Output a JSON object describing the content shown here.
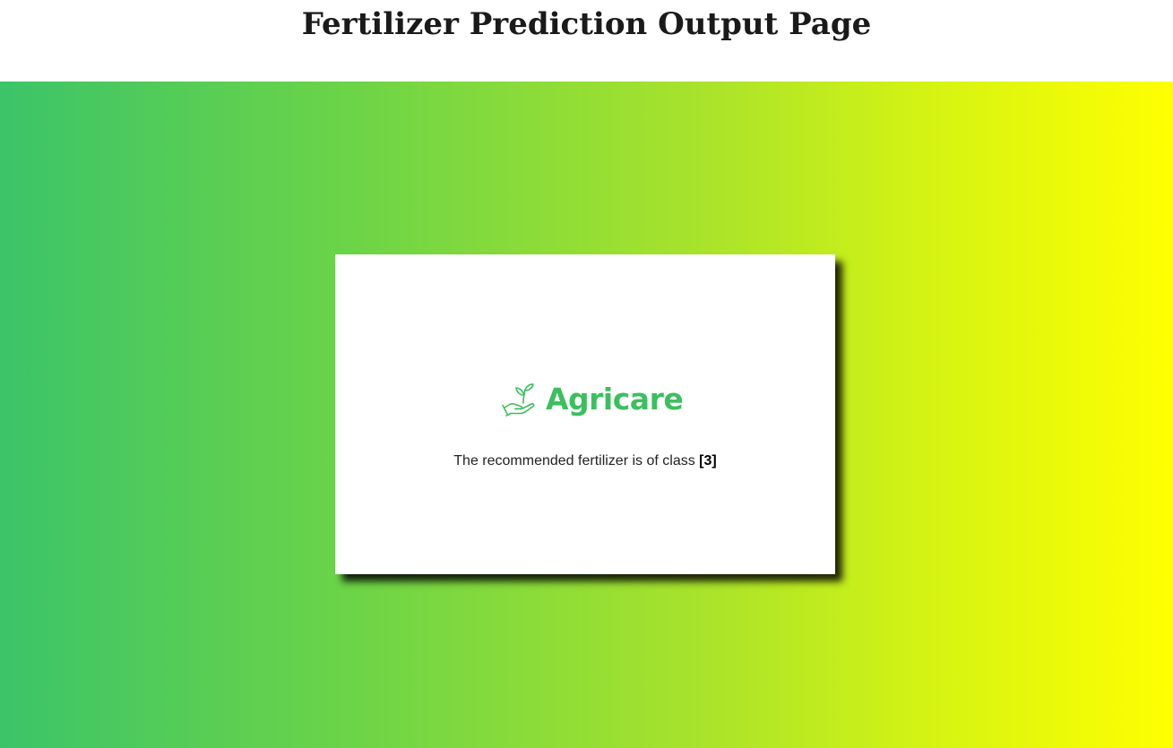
{
  "header": {
    "title": "Fertilizer Prediction Output Page"
  },
  "card": {
    "brand_name": "Agricare",
    "brand_icon": "plant-in-hand-icon",
    "result_text": "The recommended fertilizer is of class ",
    "result_value": "[3]"
  },
  "colors": {
    "gradient_start": "#3cc469",
    "gradient_end": "#ffff00",
    "brand": "#3cbf5f"
  }
}
